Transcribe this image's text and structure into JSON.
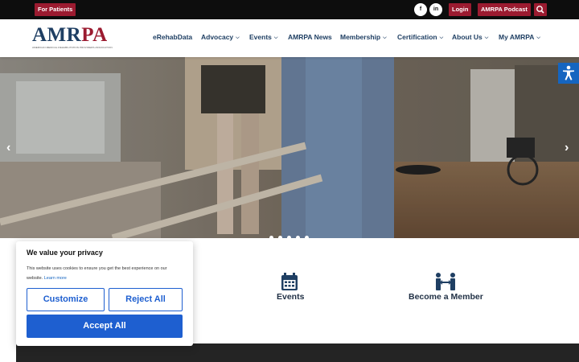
{
  "topbar": {
    "for_patients": "For Patients",
    "login": "Login",
    "podcast": "AMRPA Podcast",
    "social_facebook": "f",
    "social_linkedin": "in"
  },
  "logo": {
    "text": "AMRPA",
    "subtitle": "AMERICAN MEDICAL REHABILITATION PROVIDERS ASSOCIATION"
  },
  "nav": {
    "items": [
      {
        "label": "eRehabData",
        "dropdown": false
      },
      {
        "label": "Advocacy",
        "dropdown": true
      },
      {
        "label": "Events",
        "dropdown": true
      },
      {
        "label": "AMRPA News",
        "dropdown": false
      },
      {
        "label": "Membership",
        "dropdown": true
      },
      {
        "label": "Certification",
        "dropdown": true
      },
      {
        "label": "About Us",
        "dropdown": true
      },
      {
        "label": "My AMRPA",
        "dropdown": true
      }
    ]
  },
  "hero": {
    "prev_arrow": "‹",
    "next_arrow": "›",
    "slide_count": 5,
    "active_slide": 1
  },
  "features": {
    "events": "Events",
    "member": "Become a Member"
  },
  "cookie": {
    "title": "We value your privacy",
    "text": "This website uses cookies to ensure you get the best experience on our website.",
    "learn_more": "Learn more",
    "customize": "Customize",
    "reject": "Reject All",
    "accept": "Accept All"
  },
  "colors": {
    "brand_red": "#9b1b30",
    "brand_navy": "#1f3f63",
    "cookie_blue": "#1e5fd0",
    "a11y_blue": "#1565c0"
  },
  "icons": {
    "search": "search-icon",
    "accessibility": "accessibility-icon",
    "calendar": "calendar-icon",
    "handshake": "people-exchange-icon"
  }
}
